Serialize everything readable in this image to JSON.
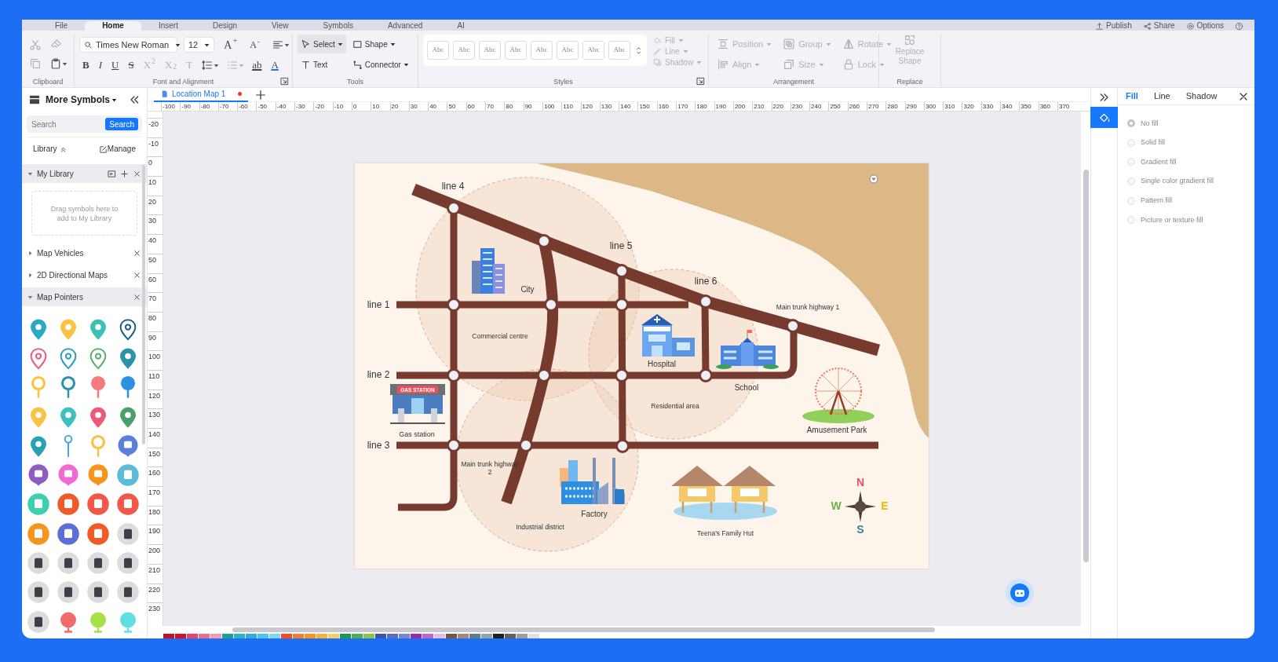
{
  "menu_tabs": [
    {
      "label": "File",
      "selected": false
    },
    {
      "label": "Home",
      "selected": true
    },
    {
      "label": "Insert",
      "selected": false
    },
    {
      "label": "Design",
      "selected": false
    },
    {
      "label": "View",
      "selected": false
    },
    {
      "label": "Symbols",
      "selected": false
    },
    {
      "label": "Advanced",
      "selected": false
    },
    {
      "label": "AI",
      "selected": false
    }
  ],
  "top_actions": [
    {
      "label": "Publish",
      "kind": "publish"
    },
    {
      "label": "Share",
      "kind": "share"
    },
    {
      "label": "Options",
      "kind": "options"
    }
  ],
  "ribbon": {
    "clipboard": {
      "label": "Clipboard"
    },
    "font": {
      "label": "Font and Alignment",
      "family": "Times New Roman",
      "size": "12",
      "size_buttons": [
        {
          "label": "A$^{+}$",
          "kind": "grow"
        },
        {
          "label": "A$^{-}$",
          "kind": "shrink"
        }
      ],
      "format_buttons": [
        {
          "label": "B",
          "kind": "bold",
          "disabled": false
        },
        {
          "label": "I",
          "kind": "italic",
          "disabled": false
        },
        {
          "label": "U",
          "kind": "underline",
          "disabled": false
        },
        {
          "label": "S",
          "kind": "strike",
          "disabled": false
        },
        {
          "label": "X$^{2}$",
          "kind": "super",
          "disabled": true
        },
        {
          "label": "X$_{2}$",
          "kind": "sub",
          "disabled": true
        },
        {
          "label": "T",
          "kind": "clear",
          "disabled": true
        },
        {
          "kind": "spacing",
          "disabled": false
        },
        {
          "kind": "list",
          "disabled": true
        },
        {
          "label": "ab",
          "kind": "highlight",
          "disabled": false
        },
        {
          "label": "A",
          "kind": "color",
          "disabled": false
        }
      ]
    },
    "tools": {
      "label": "Tools",
      "items": [
        {
          "label": "Select",
          "kind": "select",
          "selected": true,
          "dropdown": true
        },
        {
          "label": "Shape",
          "kind": "shape",
          "selected": false,
          "dropdown": true
        },
        {
          "label": "Text",
          "kind": "text",
          "selected": false,
          "dropdown": false
        },
        {
          "label": "Connector",
          "kind": "connector",
          "selected": false,
          "dropdown": true
        }
      ]
    },
    "styles": {
      "label": "Styles",
      "samples": [
        "Abc",
        "Abc",
        "Abc",
        "Abc",
        "Abc",
        "Abc",
        "Abc",
        "Abc"
      ],
      "format": [
        {
          "label": "Fill",
          "kind": "fill",
          "disabled": true
        },
        {
          "label": "Line",
          "kind": "line",
          "disabled": true
        },
        {
          "label": "Shadow",
          "kind": "shadow",
          "disabled": true
        }
      ]
    },
    "arrangement": {
      "label": "Arrangement",
      "items": [
        {
          "label": "Position",
          "kind": "position",
          "disabled": true
        },
        {
          "label": "Group",
          "kind": "group",
          "disabled": true
        },
        {
          "label": "Rotate",
          "kind": "rotate",
          "disabled": true
        },
        {
          "label": "Align",
          "kind": "align",
          "disabled": true
        },
        {
          "label": "Size",
          "kind": "size",
          "disabled": true
        },
        {
          "label": "Lock",
          "kind": "lock",
          "disabled": true
        }
      ]
    },
    "replace": {
      "label": "Replace",
      "button": {
        "label": "Replace Shape",
        "disabled": true
      }
    }
  },
  "symbols_panel": {
    "title": "More Symbols",
    "search": {
      "placeholder": "Search",
      "button": "Search"
    },
    "library": "Library",
    "manage": "Manage",
    "sections": [
      {
        "title": "My Library",
        "kind": "library",
        "expanded": true,
        "hint": "Drag symbols here to add to My Library"
      },
      {
        "title": "Map Vehicles",
        "kind": "set",
        "expanded": false
      },
      {
        "title": "2D Directional Maps",
        "kind": "set",
        "expanded": false
      },
      {
        "title": "Map Pointers",
        "kind": "set",
        "expanded": true
      }
    ]
  },
  "document_tab": {
    "title": "Location Map 1",
    "modified": true
  },
  "ruler_h": [
    "-100",
    "-90",
    "-80",
    "-70",
    "-60",
    "-50",
    "-40",
    "-30",
    "-20",
    "-10",
    "0",
    "10",
    "20",
    "30",
    "40",
    "50",
    "60",
    "70",
    "80",
    "90",
    "100",
    "110",
    "120",
    "130",
    "140",
    "150",
    "160",
    "170",
    "180",
    "190",
    "200",
    "210",
    "220",
    "230",
    "240",
    "250",
    "260",
    "270",
    "280",
    "290",
    "300",
    "310",
    "320",
    "330",
    "340",
    "350",
    "360",
    "370"
  ],
  "ruler_v": [
    "-20",
    "-10",
    "0",
    "10",
    "20",
    "30",
    "40",
    "50",
    "60",
    "70",
    "80",
    "90",
    "100",
    "110",
    "120",
    "130",
    "140",
    "150",
    "160",
    "170",
    "180",
    "190",
    "200",
    "210",
    "220",
    "230"
  ],
  "map": {
    "road_labels": [
      {
        "label": "line 4",
        "kind": "l4"
      },
      {
        "label": "line 5",
        "kind": "l5"
      },
      {
        "label": "line 6",
        "kind": "l6"
      },
      {
        "label": "line 1",
        "kind": "l1"
      },
      {
        "label": "line 2",
        "kind": "l2"
      },
      {
        "label": "line 3",
        "kind": "l3"
      }
    ],
    "places": [
      {
        "label": "City",
        "kind": "city"
      },
      {
        "label": "Commercial centre",
        "kind": "commercial"
      },
      {
        "label": "Hospital",
        "kind": "hospital"
      },
      {
        "label": "Main trunk highway 1",
        "kind": "highway1"
      },
      {
        "label": "School",
        "kind": "school"
      },
      {
        "label": "Residential area",
        "kind": "residential"
      },
      {
        "label": "Amusement Park",
        "kind": "park"
      },
      {
        "label": "Gas station",
        "kind": "gas"
      },
      {
        "label": "Main trunk highway 2",
        "kind": "highway2"
      },
      {
        "label": "Factory",
        "kind": "factory"
      },
      {
        "label": "Industrial district",
        "kind": "industrial"
      },
      {
        "label": "Teena's Family Hut",
        "kind": "hut"
      }
    ],
    "gas_sign": "GAS STATION",
    "compass": [
      {
        "label": "N",
        "kind": "n",
        "color": "#e8505b"
      },
      {
        "label": "W",
        "kind": "w",
        "color": "#6ab04c"
      },
      {
        "label": "E",
        "kind": "e",
        "color": "#f5b800"
      },
      {
        "label": "S",
        "kind": "s",
        "color": "#3d7f94"
      }
    ]
  },
  "format_panel": {
    "tabs": [
      {
        "label": "Fill",
        "selected": true
      },
      {
        "label": "Line",
        "selected": false
      },
      {
        "label": "Shadow",
        "selected": false
      }
    ],
    "options": [
      {
        "label": "No fill",
        "selected": true
      },
      {
        "label": "Solid fill",
        "selected": false
      },
      {
        "label": "Gradient fill",
        "selected": false
      },
      {
        "label": "Single color gradient fill",
        "selected": false
      },
      {
        "label": "Pattern fill",
        "selected": false
      },
      {
        "label": "Picture or texture fill",
        "selected": false
      }
    ]
  },
  "palette": [
    {
      "color": "#c0142a"
    },
    {
      "color": "#d0112b"
    },
    {
      "color": "#e8436b"
    },
    {
      "color": "#ee6d8f"
    },
    {
      "color": "#f29bb3"
    },
    {
      "color": "#1e9e99"
    },
    {
      "color": "#2bb3c0"
    },
    {
      "color": "#35a7e0"
    },
    {
      "color": "#4fc3f0"
    },
    {
      "color": "#7fd6f5"
    },
    {
      "color": "#f04e23"
    },
    {
      "color": "#f57c2a"
    },
    {
      "color": "#f7941d"
    },
    {
      "color": "#fbb034"
    },
    {
      "color": "#fcc96b"
    },
    {
      "color": "#1a9850"
    },
    {
      "color": "#4caf50"
    },
    {
      "color": "#8bc34a"
    },
    {
      "color": "#3f51b5"
    },
    {
      "color": "#5c6bc0"
    },
    {
      "color": "#7986cb"
    },
    {
      "color": "#9c27b0"
    },
    {
      "color": "#ba68c8"
    },
    {
      "color": "#e1bee7"
    },
    {
      "color": "#795548"
    },
    {
      "color": "#a1887f"
    },
    {
      "color": "#607d8b"
    },
    {
      "color": "#90a4ae"
    },
    {
      "color": "#212121"
    },
    {
      "color": "#616161"
    },
    {
      "color": "#9e9e9e"
    },
    {
      "color": "#e0e0e0"
    }
  ]
}
